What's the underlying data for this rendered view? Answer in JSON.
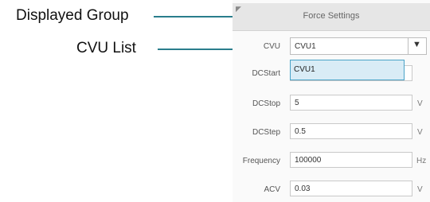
{
  "callouts": {
    "displayed_group": "Displayed Group",
    "cvu_list": "CVU List"
  },
  "panel": {
    "title": "Force Settings",
    "cvu": {
      "label": "CVU",
      "value": "CVU1",
      "options": [
        "CVU1"
      ]
    },
    "fields": [
      {
        "label": "DCStart",
        "value": "",
        "unit": ""
      },
      {
        "label": "DCStop",
        "value": "5",
        "unit": "V"
      },
      {
        "label": "DCStep",
        "value": "0.5",
        "unit": "V"
      },
      {
        "label": "Frequency",
        "value": "100000",
        "unit": "Hz"
      },
      {
        "label": "ACV",
        "value": "0.03",
        "unit": "V"
      }
    ]
  },
  "colors": {
    "leader_line": "#2a7d8c",
    "dropdown_highlight": "#d9ecf6",
    "dropdown_border": "#4aa3c8"
  }
}
